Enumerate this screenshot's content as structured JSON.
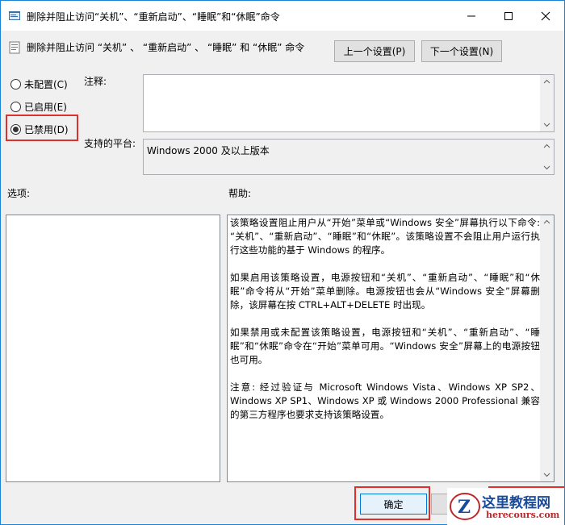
{
  "window": {
    "title": "删除并阻止访问“关机”、“重新启动”、“睡眠”和“休眠”命令"
  },
  "header": {
    "setting_name": "删除并阻止访问 “关机” 、 “重新启动” 、 “睡眠” 和 “休眠” 命令",
    "prev_label": "上一个设置(P)",
    "next_label": "下一个设置(N)"
  },
  "state": {
    "not_configured": "未配置(C)",
    "enabled": "已启用(E)",
    "disabled": "已禁用(D)",
    "selected": "disabled"
  },
  "comment": {
    "label": "注释:",
    "value": ""
  },
  "platform": {
    "label": "支持的平台:",
    "value": "Windows 2000 及以上版本"
  },
  "options": {
    "label": "选项:"
  },
  "help": {
    "label": "帮助:",
    "paragraphs": [
      "该策略设置阻止用户从“开始”菜单或“Windows 安全”屏幕执行以下命令: “关机”、“重新启动”、“睡眠”和“休眠”。该策略设置不会阻止用户运行执行这些功能的基于 Windows 的程序。",
      "如果启用该策略设置，电源按钮和“关机”、“重新启动”、“睡眠”和“休眠”命令将从“开始”菜单删除。电源按钮也会从“Windows 安全”屏幕删除，该屏幕在按 CTRL+ALT+DELETE 时出现。",
      "如果禁用或未配置该策略设置，电源按钮和“关机”、“重新启动”、“睡眠”和“休眠”命令在“开始”菜单可用。“Windows 安全”屏幕上的电源按钮也可用。",
      "注意: 经过验证与 Microsoft Windows Vista、Windows XP SP2、Windows XP SP1、Windows XP 或 Windows 2000 Professional 兼容的第三方程序也要求支持该策略设置。"
    ]
  },
  "footer": {
    "ok_label": "确定"
  },
  "watermark": {
    "line1": "这里教程网",
    "line2": "herecours.com"
  },
  "colors": {
    "highlight": "#e0302b",
    "accent": "#0078d7"
  }
}
